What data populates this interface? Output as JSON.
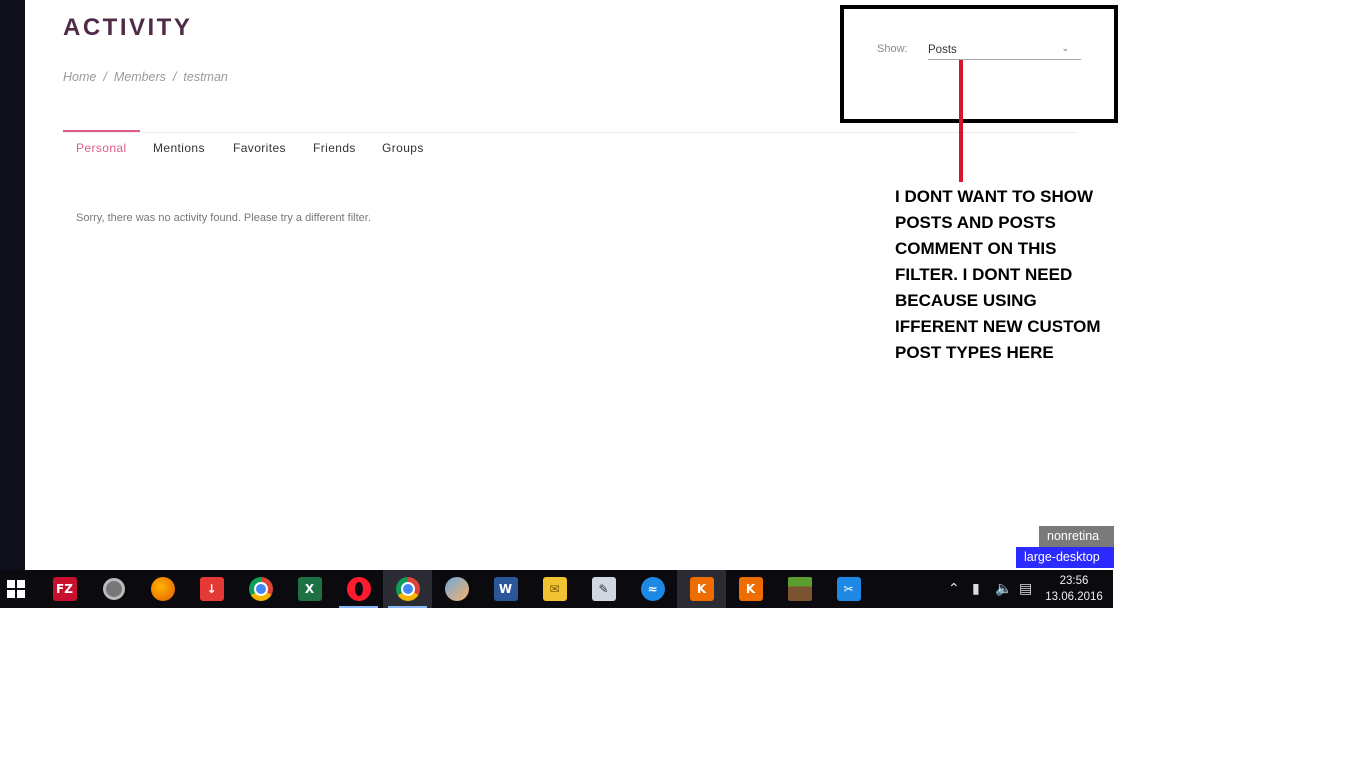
{
  "page": {
    "title": "ACTIVITY",
    "breadcrumb": [
      "Home",
      "Members",
      "testman"
    ],
    "tabs": [
      {
        "label": "Personal",
        "active": true
      },
      {
        "label": "Mentions",
        "active": false
      },
      {
        "label": "Favorites",
        "active": false
      },
      {
        "label": "Friends",
        "active": false
      },
      {
        "label": "Groups",
        "active": false
      }
    ],
    "empty_message": "Sorry, there was no activity found. Please try a different filter."
  },
  "filter": {
    "label": "Show:",
    "selected": "Posts"
  },
  "annotation": {
    "lines": [
      "I DONT WANT TO SHOW",
      "POSTS AND POSTS",
      "COMMENT ON THIS",
      "FILTER. I DONT NEED",
      "BECAUSE USING",
      "IFFERENT NEW CUSTOM",
      "POST TYPES HERE"
    ],
    "color": "#d8152c"
  },
  "badges": {
    "retina": "nonretina",
    "breakpoint": "large-desktop"
  },
  "taskbar": {
    "apps": [
      {
        "name": "windows-start-icon"
      },
      {
        "name": "filezilla-icon",
        "text": "FZ",
        "color": "#c8102e"
      },
      {
        "name": "app-gray-icon"
      },
      {
        "name": "firefox-icon"
      },
      {
        "name": "download-icon"
      },
      {
        "name": "chrome-icon"
      },
      {
        "name": "excel-icon"
      },
      {
        "name": "opera-icon"
      },
      {
        "name": "chrome-user-icon"
      },
      {
        "name": "paint-icon"
      },
      {
        "name": "word-icon"
      },
      {
        "name": "mail-icon"
      },
      {
        "name": "notes-icon"
      },
      {
        "name": "web-icon"
      },
      {
        "name": "k-app-icon"
      },
      {
        "name": "k-app-2-icon"
      },
      {
        "name": "minecraft-icon"
      },
      {
        "name": "snipping-tool-icon"
      }
    ],
    "time": "23:56",
    "date": "13.06.2016"
  }
}
